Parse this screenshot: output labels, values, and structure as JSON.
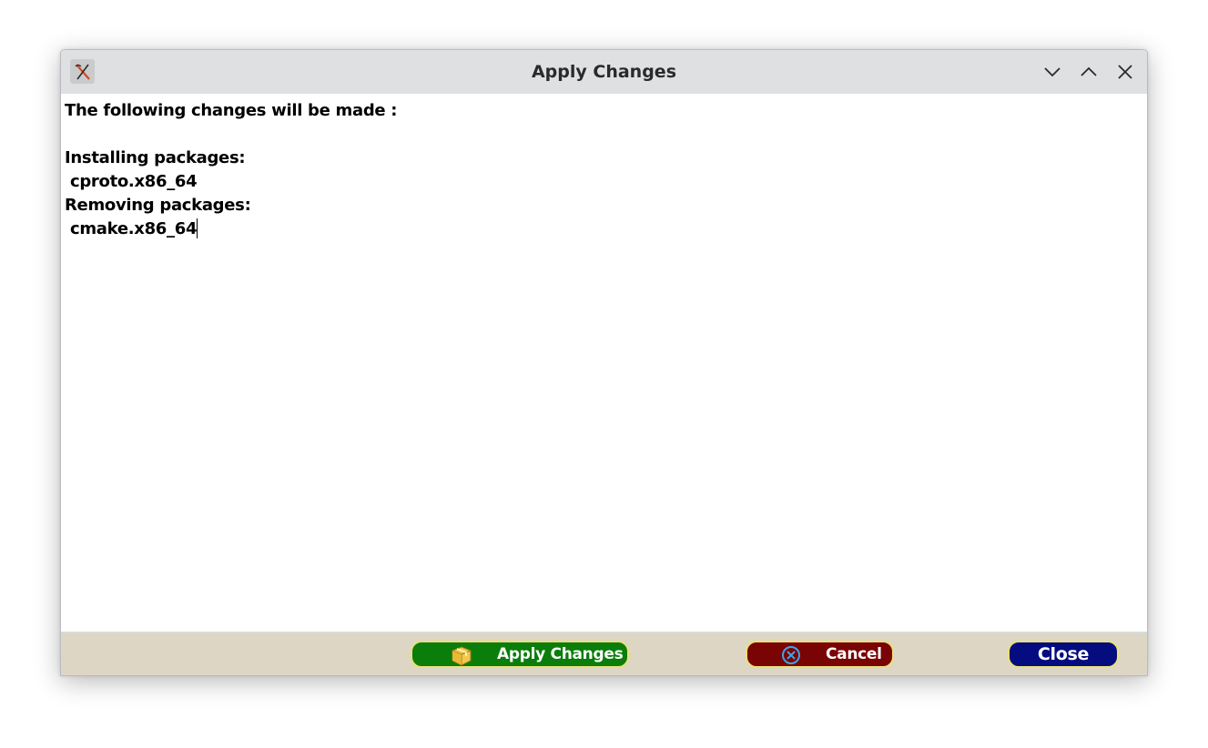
{
  "window": {
    "title": "Apply Changes",
    "app_icon": "x-app-icon",
    "controls": [
      "minimize-icon",
      "maximize-icon",
      "close-icon"
    ]
  },
  "content": {
    "lines": [
      "The following changes will be made :",
      "",
      "Installing packages:",
      " cproto.x86_64",
      "Removing packages:",
      " cmake.x86_64"
    ]
  },
  "footer": {
    "apply_label": "Apply Changes",
    "apply_icon": "package-box-icon",
    "cancel_label": "Cancel",
    "cancel_icon": "cancel-circle-icon",
    "close_label": "Close"
  },
  "colors": {
    "apply_bg": "#0a7d0a",
    "cancel_bg": "#7a0303",
    "close_bg": "#050c80",
    "button_border": "#e9e07a",
    "footer_bg": "#ded6c4",
    "titlebar_bg": "#dee0e2"
  }
}
